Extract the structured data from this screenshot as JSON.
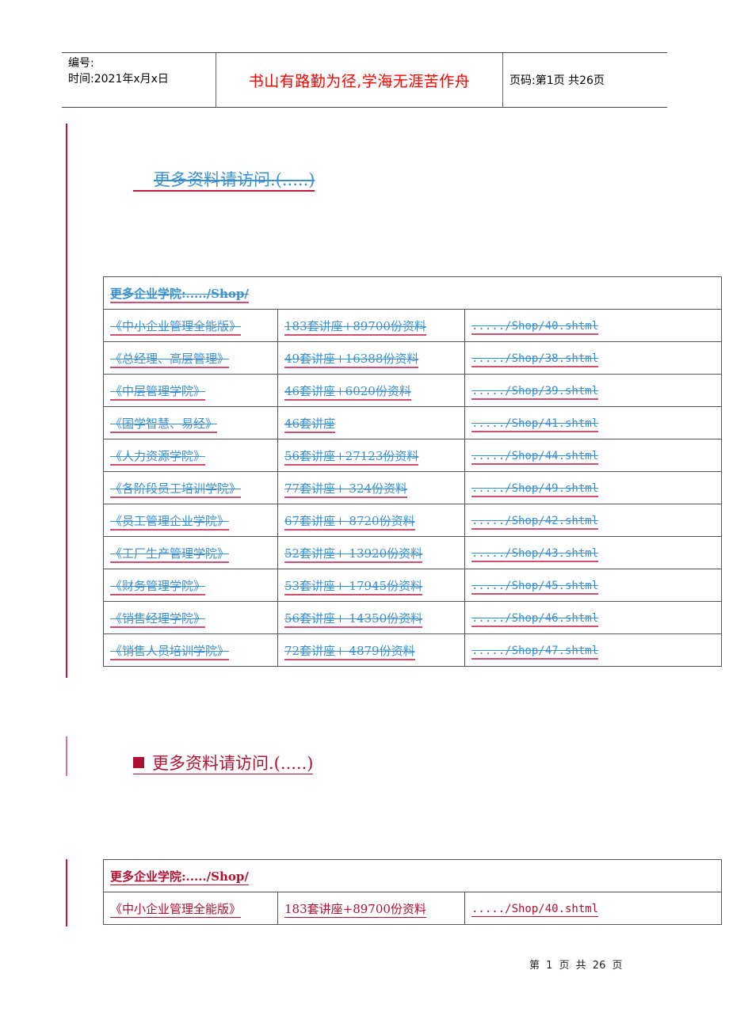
{
  "header": {
    "number_label": "编号:",
    "time_label": "时间:2021年x月x日",
    "motto": "书山有路勤为径,学海无涯苦作舟",
    "page_info": "页码:第1页 共26页"
  },
  "sections": [
    {
      "link_text": "更多资料请访问.(.....)",
      "table": {
        "title": "更多企业学院:...../Shop/",
        "rows": [
          {
            "name": "《中小企业管理全能版》",
            "desc": "183套讲座+89700份资料",
            "url": "...../Shop/40.shtml"
          },
          {
            "name": "《总经理、高层管理》",
            "desc": "49套讲座+16388份资料",
            "url": "...../Shop/38.shtml"
          },
          {
            "name": "《中层管理学院》",
            "desc": "46套讲座+6020份资料",
            "url": "...../Shop/39.shtml"
          },
          {
            "name": "《国学智慧、易经》",
            "desc": "46套讲座",
            "url": "...../Shop/41.shtml"
          },
          {
            "name": "《人力资源学院》",
            "desc": "56套讲座+27123份资料",
            "url": "...../Shop/44.shtml"
          },
          {
            "name": "《各阶段员工培训学院》",
            "desc": "77套讲座+ 324份资料",
            "url": "...../Shop/49.shtml"
          },
          {
            "name": "《员工管理企业学院》",
            "desc": "67套讲座+ 8720份资料",
            "url": "...../Shop/42.shtml"
          },
          {
            "name": "《工厂生产管理学院》",
            "desc": "52套讲座+ 13920份资料",
            "url": "...../Shop/43.shtml"
          },
          {
            "name": "《财务管理学院》",
            "desc": "53套讲座+ 17945份资料",
            "url": "...../Shop/45.shtml"
          },
          {
            "name": "《销售经理学院》",
            "desc": "56套讲座+ 14350份资料",
            "url": "...../Shop/46.shtml"
          },
          {
            "name": "《销售人员培训学院》",
            "desc": "72套讲座+ 4879份资料",
            "url": "...../Shop/47.shtml"
          }
        ]
      }
    },
    {
      "link_text": "更多资料请访问.(.....)",
      "table": {
        "title": "更多企业学院:...../Shop/",
        "rows": [
          {
            "name": "《中小企业管理全能版》",
            "desc": "183套讲座+89700份资料",
            "url": "...../Shop/40.shtml"
          }
        ]
      }
    }
  ],
  "footer": {
    "page_info": "第 1 页 共 26 页"
  },
  "colors": {
    "motto": "#ff0000",
    "link_blue": "#3a8fd0",
    "revision_red": "#c0183c"
  }
}
